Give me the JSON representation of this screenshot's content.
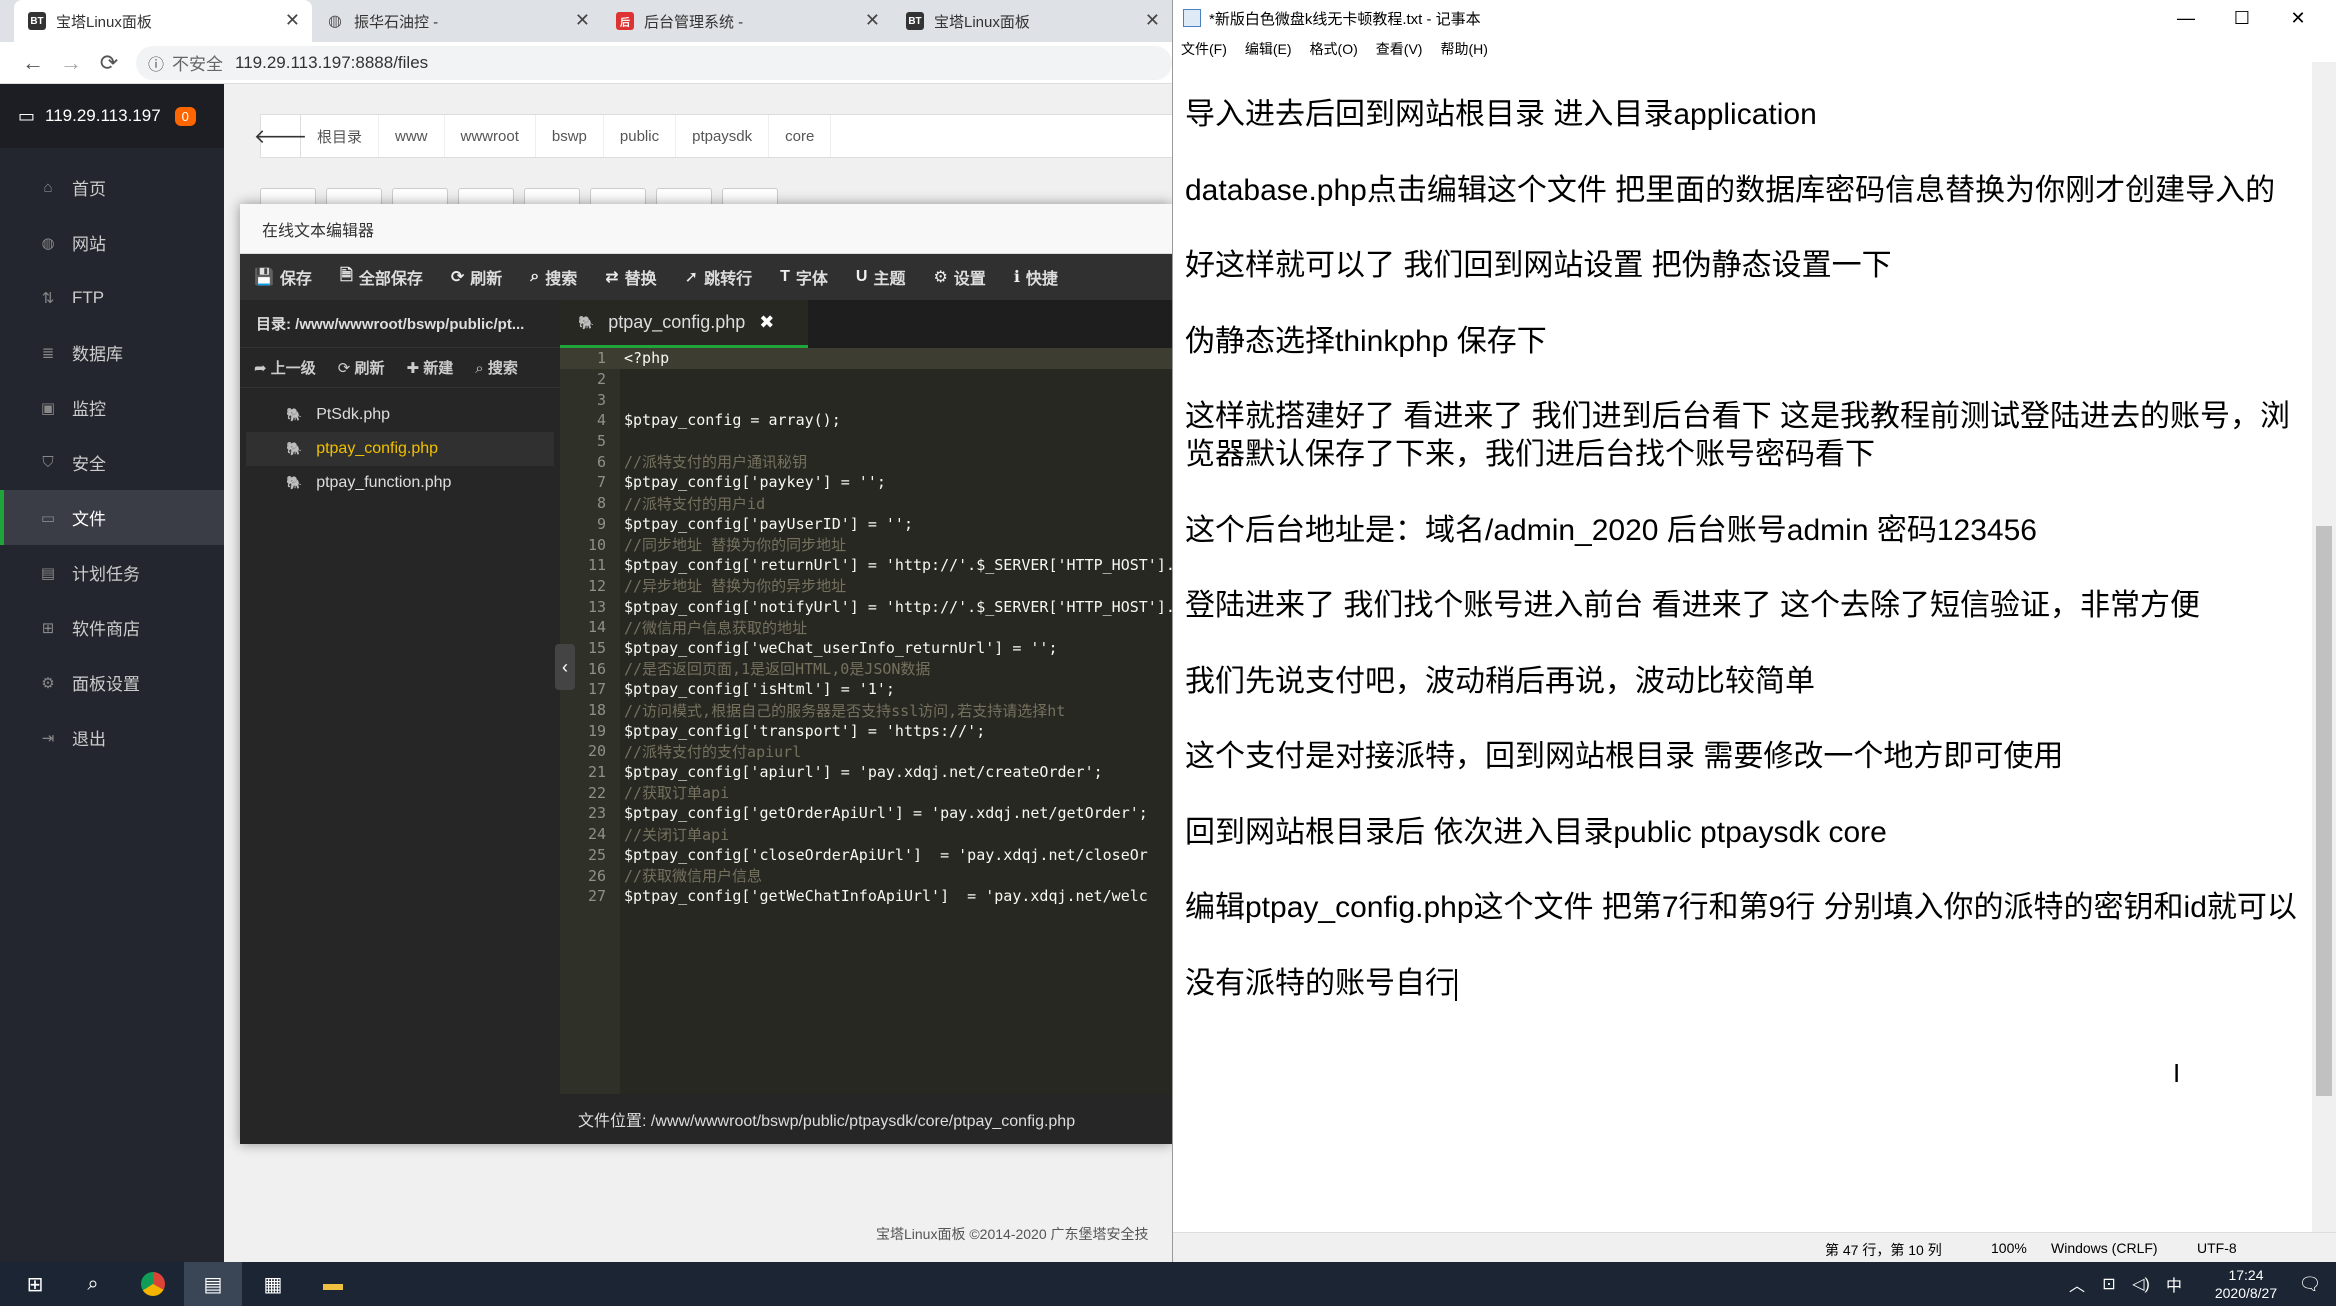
{
  "browser": {
    "tabs": [
      {
        "label": "宝塔Linux面板",
        "favicon": "BT"
      },
      {
        "label": "振华石油控 -",
        "favicon": "globe"
      },
      {
        "label": "后台管理系统 -",
        "favicon": "red"
      },
      {
        "label": "宝塔Linux面板",
        "favicon": "BT"
      }
    ],
    "insecure_label": "不安全",
    "url": "119.29.113.197:8888/files"
  },
  "sidebar": {
    "host": "119.29.113.197",
    "badge": "0",
    "items": [
      {
        "label": "首页",
        "icon": "home-icon"
      },
      {
        "label": "网站",
        "icon": "globe-icon"
      },
      {
        "label": "FTP",
        "icon": "ftp-icon"
      },
      {
        "label": "数据库",
        "icon": "database-icon"
      },
      {
        "label": "监控",
        "icon": "monitor-icon"
      },
      {
        "label": "安全",
        "icon": "shield-icon"
      },
      {
        "label": "文件",
        "icon": "folder-icon"
      },
      {
        "label": "计划任务",
        "icon": "calendar-icon"
      },
      {
        "label": "软件商店",
        "icon": "grid-icon"
      },
      {
        "label": "面板设置",
        "icon": "gear-icon"
      },
      {
        "label": "退出",
        "icon": "logout-icon"
      }
    ],
    "active_index": 6
  },
  "breadcrumb": [
    "根目录",
    "www",
    "wwwroot",
    "bswp",
    "public",
    "ptpaysdk",
    "core"
  ],
  "footer": "宝塔Linux面板 ©2014-2020 广东堡塔安全技",
  "editor": {
    "title": "在线文本编辑器",
    "toolbar": [
      "保存",
      "全部保存",
      "刷新",
      "搜索",
      "替换",
      "跳转行",
      "字体",
      "主题",
      "设置",
      "快捷"
    ],
    "directory": "目录: /www/wwwroot/bswp/public/pt...",
    "tree_actions": [
      "上一级",
      "刷新",
      "新建",
      "搜索"
    ],
    "files": [
      "PtSdk.php",
      "ptpay_config.php",
      "ptpay_function.php"
    ],
    "active_file_index": 1,
    "tab_label": "ptpay_config.php",
    "code_lines": [
      "<?php",
      "",
      "",
      "$ptpay_config = array();",
      "",
      "//派特支付的用户通讯秘钥",
      "$ptpay_config['paykey'] = '';",
      "//派特支付的用户id",
      "$ptpay_config['payUserID'] = '';",
      "//同步地址 替换为你的同步地址",
      "$ptpay_config['returnUrl'] = 'http://'.$_SERVER['HTTP_HOST'].",
      "//异步地址 替换为你的异步地址",
      "$ptpay_config['notifyUrl'] = 'http://'.$_SERVER['HTTP_HOST'].",
      "//微信用户信息获取的地址",
      "$ptpay_config['weChat_userInfo_returnUrl'] = '';",
      "//是否返回页面,1是返回HTML,0是JSON数据",
      "$ptpay_config['isHtml'] = '1';",
      "//访问模式,根据自己的服务器是否支持ssl访问,若支持请选择ht",
      "$ptpay_config['transport'] = 'https://';",
      "//派特支付的支付apiurl",
      "$ptpay_config['apiurl'] = 'pay.xdqj.net/createOrder';",
      "//获取订单api",
      "$ptpay_config['getOrderApiUrl'] = 'pay.xdqj.net/getOrder';",
      "//关闭订单api",
      "$ptpay_config['closeOrderApiUrl']  = 'pay.xdqj.net/closeOr",
      "//获取微信用户信息",
      "$ptpay_config['getWeChatInfoApiUrl']  = 'pay.xdqj.net/welc"
    ],
    "file_path": "文件位置: /www/wwwroot/bswp/public/ptpaysdk/core/ptpay_config.php"
  },
  "notepad": {
    "title": "*新版白色微盘k线无卡顿教程.txt - 记事本",
    "menu": [
      "文件(F)",
      "编辑(E)",
      "格式(O)",
      "查看(V)",
      "帮助(H)"
    ],
    "paragraphs": [
      "导入进去后回到网站根目录   进入目录application",
      "database.php点击编辑这个文件 把里面的数据库密码信息替换为你刚才创建导入的",
      "好这样就可以了 我们回到网站设置 把伪静态设置一下",
      "伪静态选择thinkphp 保存下",
      "这样就搭建好了 看进来了 我们进到后台看下 这是我教程前测试登陆进去的账号，浏览器默认保存了下来，我们进后台找个账号密码看下",
      "这个后台地址是：域名/admin_2020  后台账号admin 密码123456",
      "登陆进来了 我们找个账号进入前台 看进来了 这个去除了短信验证，非常方便",
      "我们先说支付吧，波动稍后再说，波动比较简单",
      "这个支付是对接派特，回到网站根目录 需要修改一个地方即可使用",
      "回到网站根目录后 依次进入目录public  ptpaysdk core",
      "编辑ptpay_config.php这个文件 把第7行和第9行 分别填入你的派特的密钥和id就可以",
      "没有派特的账号自行"
    ],
    "status": {
      "position": "第 47 行，第 10 列",
      "zoom": "100%",
      "eol": "Windows (CRLF)",
      "encoding": "UTF-8"
    }
  },
  "taskbar": {
    "tray": "中",
    "time": "17:24",
    "date": "2020/8/27"
  }
}
